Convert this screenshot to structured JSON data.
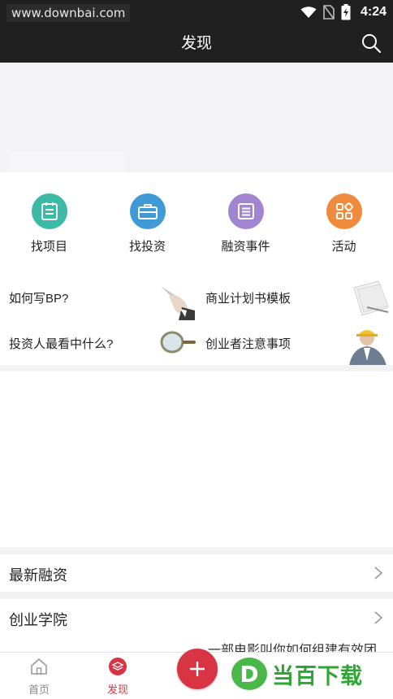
{
  "status_bar": {
    "watermark": "www.downbai.com",
    "time": "4:24",
    "icons": [
      "wifi-icon",
      "no-sim-icon",
      "battery-charging-icon"
    ]
  },
  "header": {
    "title": "发现",
    "search_icon": "search-icon"
  },
  "quick_entries": [
    {
      "label": "找项目",
      "icon": "clipboard-icon",
      "color": "#3dbaa6"
    },
    {
      "label": "找投资",
      "icon": "briefcase-icon",
      "color": "#3f9ad6"
    },
    {
      "label": "融资事件",
      "icon": "list-icon",
      "color": "#a185d1"
    },
    {
      "label": "活动",
      "icon": "grid-icon",
      "color": "#f08a3c"
    }
  ],
  "guides": [
    {
      "label": "如何写BP?",
      "image": "writing-hand-image"
    },
    {
      "label": "商业计划书模板",
      "image": "paper-stack-image"
    },
    {
      "label": "投资人最看中什么?",
      "image": "magnifier-image"
    },
    {
      "label": "创业者注意事项",
      "image": "builder-person-image"
    }
  ],
  "sections": {
    "latest_funding": "最新融资",
    "startup_academy": "创业学院",
    "academy_preview": "一部电影叫你如何组建有效团"
  },
  "bottom_nav": {
    "home": "首页",
    "discover": "发现",
    "active_color": "#d93443"
  },
  "brand": {
    "mark": "D",
    "text": "当百下载"
  }
}
